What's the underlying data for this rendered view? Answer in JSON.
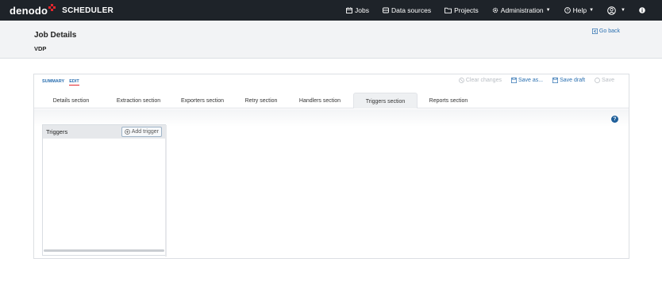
{
  "brand": {
    "logo_text": "denodo",
    "app_name": "SCHEDULER",
    "accent": "#e3262d",
    "nav_bg": "#1e2329"
  },
  "nav": {
    "jobs": "Jobs",
    "data_sources": "Data sources",
    "projects": "Projects",
    "administration": "Administration",
    "help": "Help",
    "user_icon": "user-circle-icon",
    "info_icon": "info-icon"
  },
  "header": {
    "title": "Job Details",
    "subtitle": "VDP",
    "go_back": "Go back"
  },
  "mode": {
    "summary": "SUMMARY",
    "edit": "EDIT",
    "active": "EDIT"
  },
  "actions": {
    "clear_changes": "Clear changes",
    "save_as": "Save as...",
    "save_draft": "Save draft",
    "save": "Save"
  },
  "tabs": [
    "Details section",
    "Extraction section",
    "Exporters section",
    "Retry section",
    "Handlers section",
    "Triggers section",
    "Reports section"
  ],
  "active_tab": "Triggers section",
  "triggers": {
    "title": "Triggers",
    "add_button": "Add trigger"
  },
  "help": {
    "label": "?"
  },
  "colors": {
    "link": "#2a6fb0",
    "disabled": "#b7bcc2",
    "help": "#1f5f9a"
  }
}
